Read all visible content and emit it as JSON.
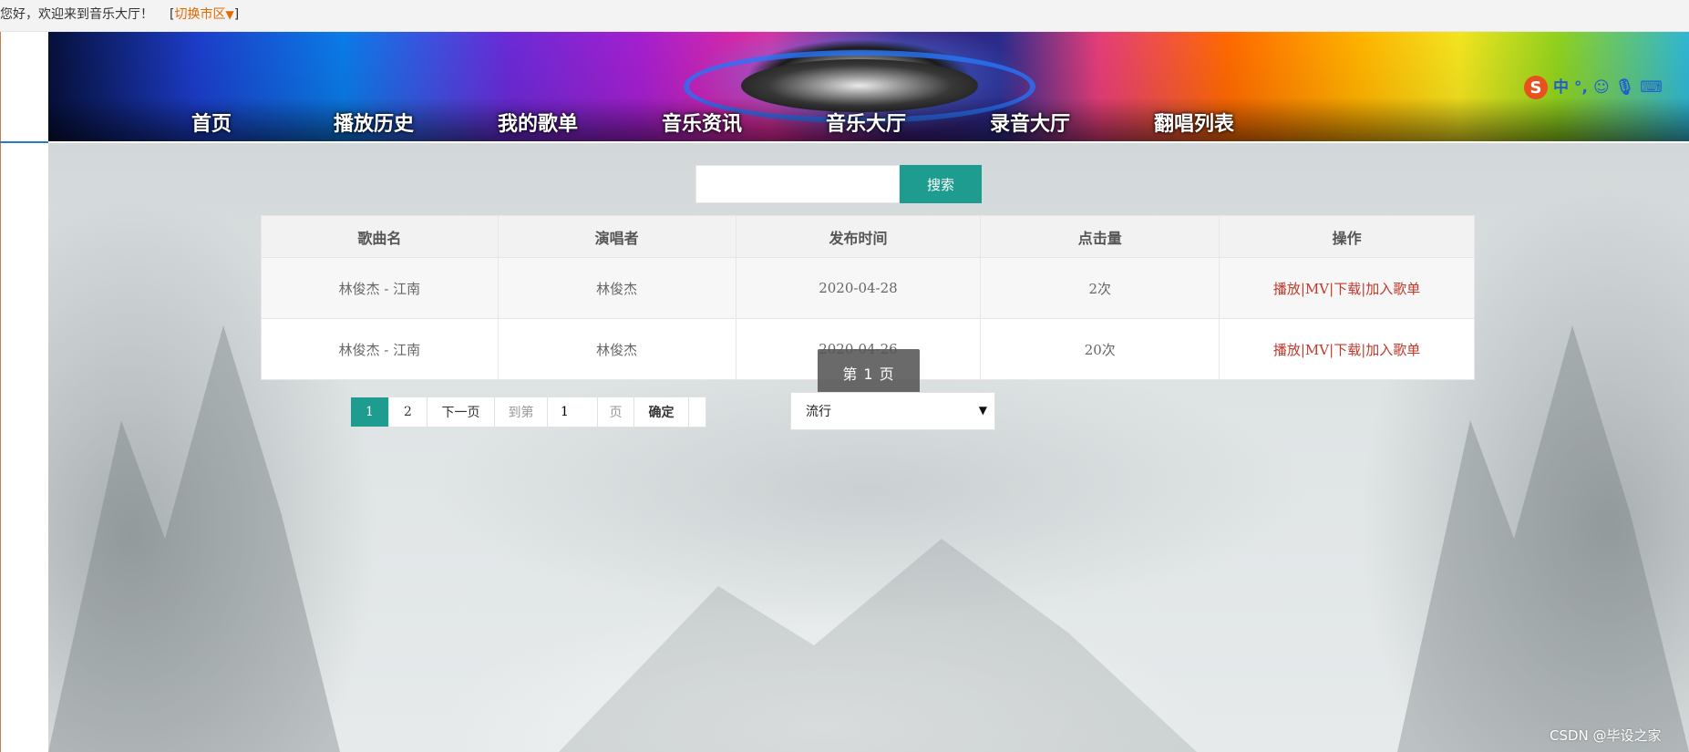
{
  "topbar": {
    "greeting": "您好，欢迎来到音乐大厅！",
    "switch_open": "[",
    "switch_label": "切换市区",
    "switch_arrow": "▼",
    "switch_close": "]"
  },
  "nav": {
    "items": [
      "首页",
      "播放历史",
      "我的歌单",
      "音乐资讯",
      "音乐大厅",
      "录音大厅",
      "翻唱列表"
    ]
  },
  "ime": {
    "logo": "S",
    "mode": "中",
    "punct": "°,",
    "icons": [
      "smiley-icon",
      "microphone-icon",
      "keyboard-icon"
    ]
  },
  "search": {
    "value": "",
    "button_label": "搜索"
  },
  "table": {
    "headers": [
      "歌曲名",
      "演唱者",
      "发布时间",
      "点击量",
      "操作"
    ],
    "rows": [
      {
        "song": "林俊杰 - 江南",
        "singer": "林俊杰",
        "date": "2020-04-28",
        "clicks": "2次"
      },
      {
        "song": "林俊杰 - 江南",
        "singer": "林俊杰",
        "date": "2020-04-26",
        "clicks": "20次"
      }
    ],
    "actions": {
      "play": "播放",
      "mv": "MV",
      "download": "下载",
      "add": "加入歌单",
      "sep": "|"
    }
  },
  "toast": {
    "text": "第 1 页"
  },
  "pagination": {
    "page1": "1",
    "page2": "2",
    "next": "下一页",
    "goto_prefix": "到第",
    "goto_value": "1",
    "goto_suffix": "页",
    "confirm": "确定"
  },
  "select": {
    "selected": "流行"
  },
  "watermark": "CSDN @毕设之家",
  "colors": {
    "accent": "#1e9c8f",
    "link_red": "#c0392b",
    "switch_orange": "#e46a00"
  }
}
